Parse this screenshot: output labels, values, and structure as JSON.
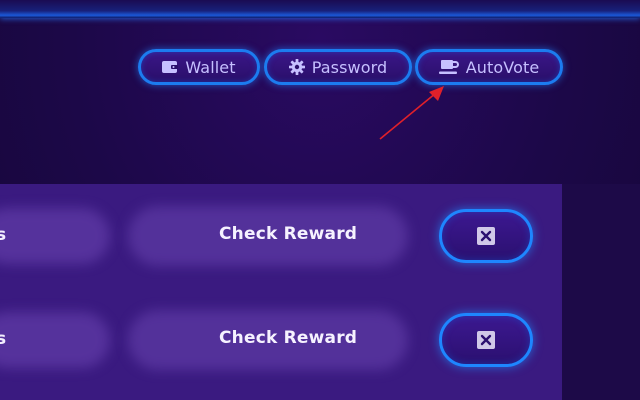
{
  "nav": {
    "wallet_label": "Wallet",
    "password_label": "Password",
    "autovote_label": "AutoVote",
    "icons": [
      "wallet-icon",
      "gear-icon",
      "coffee-cup-icon"
    ]
  },
  "rows": [
    {
      "left_text": "s",
      "action_label": "Check Reward",
      "close_icon": "close-box-icon"
    },
    {
      "left_text": "s",
      "action_label": "Check Reward",
      "close_icon": "close-box-icon"
    }
  ],
  "colors": {
    "accent_blue": "#1e86ff",
    "background": "#1c0848",
    "panel": "#3a1a80",
    "annotation_arrow": "#e0202a"
  }
}
